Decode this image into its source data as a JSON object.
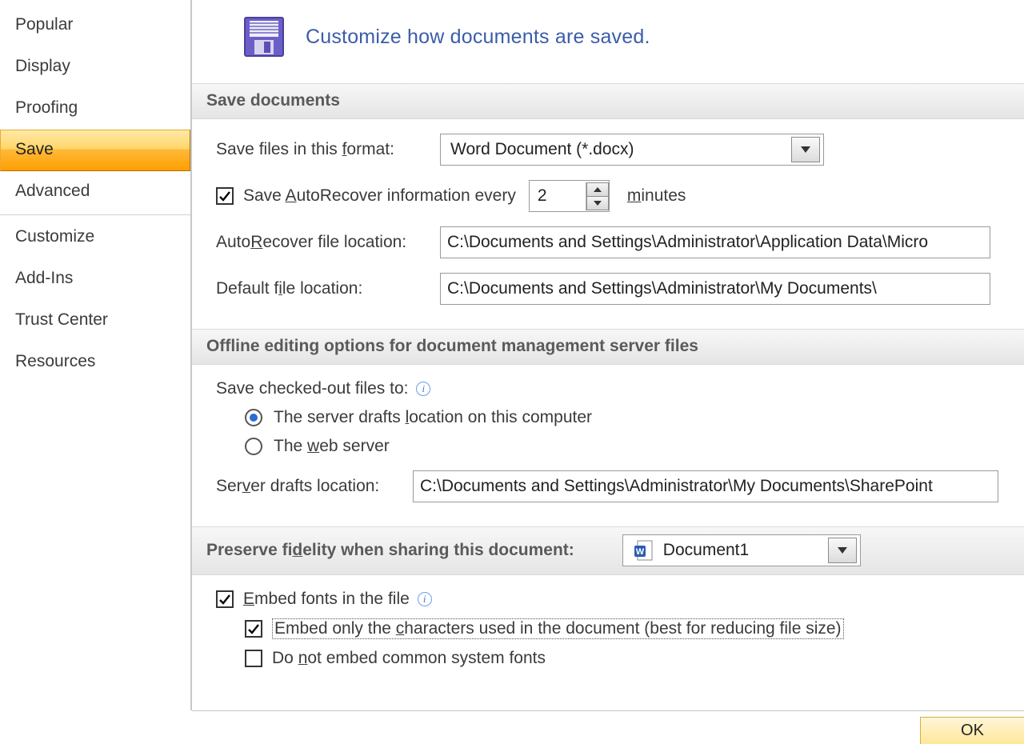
{
  "sidebar": {
    "items": [
      {
        "label": "Popular"
      },
      {
        "label": "Display"
      },
      {
        "label": "Proofing"
      },
      {
        "label": "Save"
      },
      {
        "label": "Advanced"
      },
      {
        "label": "Customize"
      },
      {
        "label": "Add-Ins"
      },
      {
        "label": "Trust Center"
      },
      {
        "label": "Resources"
      }
    ]
  },
  "header": {
    "title": "Customize how documents are saved."
  },
  "sec1": {
    "title": "Save documents",
    "format_label_pre": "Save files in this ",
    "format_label_u": "f",
    "format_label_post": "ormat:",
    "format_value": "Word Document (*.docx)",
    "autorecover_label_pre": "Save ",
    "autorecover_label_u": "A",
    "autorecover_label_post": "utoRecover information every",
    "autorecover_value": "2",
    "minutes_u": "m",
    "minutes_post": "inutes",
    "autorecover_loc_label_pre": "Auto",
    "autorecover_loc_label_u": "R",
    "autorecover_loc_label_post": "ecover file location:",
    "autorecover_loc_value": "C:\\Documents and Settings\\Administrator\\Application Data\\Micro",
    "default_loc_label_pre": "Default f",
    "default_loc_label_u": "i",
    "default_loc_label_post": "le location:",
    "default_loc_value": "C:\\Documents and Settings\\Administrator\\My Documents\\"
  },
  "sec2": {
    "title": "Offline editing options for document management server files",
    "save_to_label": "Save checked-out files to:",
    "radio1_pre": "The server drafts ",
    "radio1_u": "l",
    "radio1_post": "ocation on this computer",
    "radio2_pre": "The ",
    "radio2_u": "w",
    "radio2_post": "eb server",
    "server_drafts_label_pre": "Ser",
    "server_drafts_label_u": "v",
    "server_drafts_label_post": "er drafts location:",
    "server_drafts_value": "C:\\Documents and Settings\\Administrator\\My Documents\\SharePoint"
  },
  "sec3": {
    "title_pre": "Preserve fi",
    "title_u": "d",
    "title_post": "elity when sharing this document:",
    "doc_value": "Document1",
    "embed_pre": "",
    "embed_u": "E",
    "embed_post": "mbed fonts in the file",
    "embed_chars_pre": "Embed only the ",
    "embed_chars_u": "c",
    "embed_chars_post": "haracters used in the document (best for reducing file size)",
    "embed_common_pre": "Do ",
    "embed_common_u": "n",
    "embed_common_post": "ot embed common system fonts"
  },
  "footer": {
    "ok": "OK"
  }
}
